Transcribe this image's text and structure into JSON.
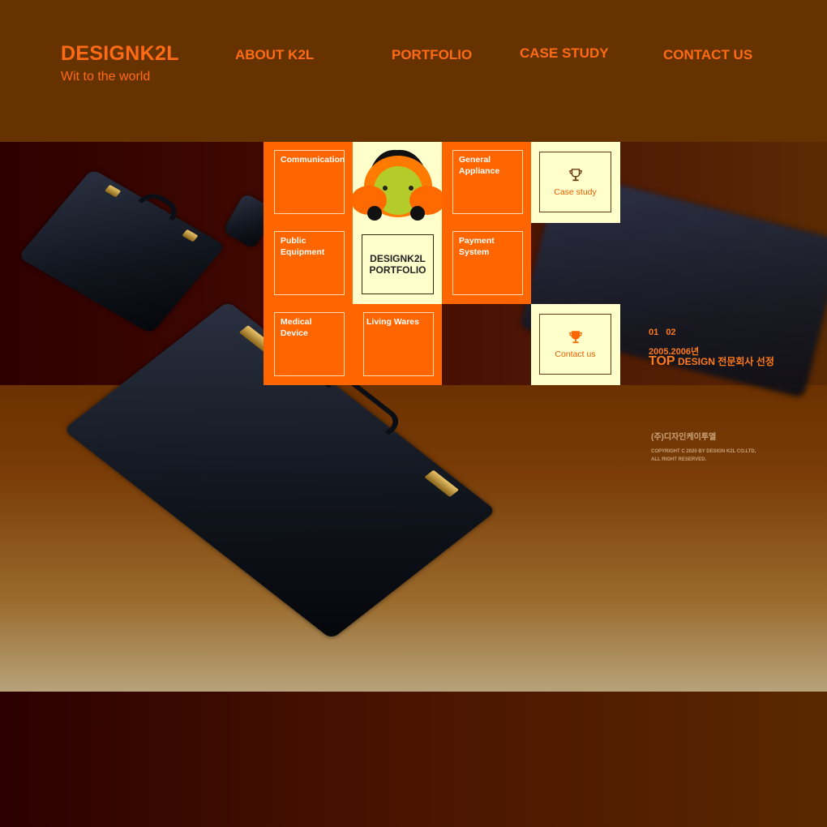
{
  "header": {
    "logo": "DESIGNK2L",
    "tagline": "Wit to the world",
    "nav": [
      "ABOUT K2L",
      "PORTFOLIO",
      "CASE STUDY",
      "CONTACT US"
    ]
  },
  "grid": {
    "communication": "Communication",
    "general_appliance": [
      "General",
      "Appliance"
    ],
    "public_equipment": [
      "Public",
      "Equipment"
    ],
    "payment_system": [
      "Payment",
      "System"
    ],
    "medical_device": [
      "Medical",
      "Device"
    ],
    "living_wares": "Living Wares",
    "portfolio": [
      "DESIGNK2L",
      "PORTFOLIO"
    ],
    "case_study": "Case study",
    "contact_us": "Contact us"
  },
  "info": {
    "pager": [
      "01",
      "02"
    ],
    "years": "2005.2006년",
    "top_word": "TOP",
    "top_rest": "DESIGN 전문회사 선정",
    "company": "(주)디자인케이투엘",
    "copyright": [
      "COPYRIGHT C 2020 BY DESIGN K2L CO.LTD,",
      "ALL RIGHT RESERVED."
    ]
  },
  "colors": {
    "accent": "#ff6600",
    "cream": "#ffffcc",
    "header_bg": "#663300"
  },
  "icons": [
    "trophy-icon"
  ]
}
